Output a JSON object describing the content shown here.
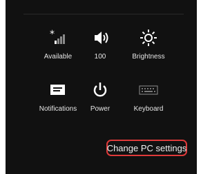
{
  "settings_tiles": [
    {
      "label": "Available",
      "icon": "network-signal-icon"
    },
    {
      "label": "100",
      "icon": "volume-icon"
    },
    {
      "label": "Brightness",
      "icon": "brightness-icon"
    },
    {
      "label": "Notifications",
      "icon": "notifications-icon"
    },
    {
      "label": "Power",
      "icon": "power-icon"
    },
    {
      "label": "Keyboard",
      "icon": "keyboard-icon"
    }
  ],
  "change_pc_settings": {
    "label": "Change PC settings"
  },
  "colors": {
    "panel": "#111111",
    "text": "#ffffff",
    "highlight": "#e03a3a"
  }
}
